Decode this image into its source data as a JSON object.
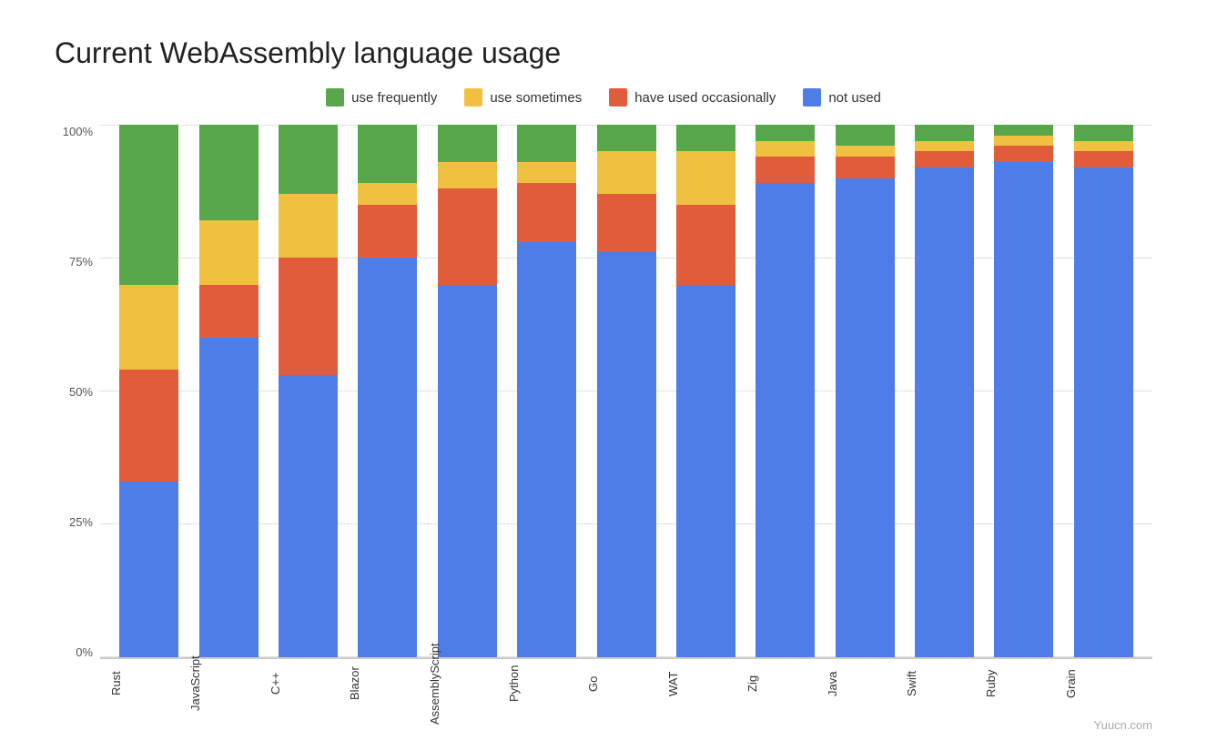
{
  "title": "Current WebAssembly language usage",
  "legend": [
    {
      "label": "use frequently",
      "color": "#57a64a"
    },
    {
      "label": "use sometimes",
      "color": "#f0c040"
    },
    {
      "label": "have used occasionally",
      "color": "#e05c3a"
    },
    {
      "label": "not used",
      "color": "#4e7de8"
    }
  ],
  "yAxis": [
    "100%",
    "75%",
    "50%",
    "25%",
    "0%"
  ],
  "colors": {
    "frequently": "#57a64a",
    "sometimes": "#f0c040",
    "occasionally": "#e05c3a",
    "notUsed": "#4e7de8"
  },
  "bars": [
    {
      "label": "Rust",
      "notUsed": 33,
      "occasionally": 21,
      "sometimes": 16,
      "frequently": 30
    },
    {
      "label": "JavaScript",
      "notUsed": 60,
      "occasionally": 10,
      "sometimes": 12,
      "frequently": 18
    },
    {
      "label": "C++",
      "notUsed": 53,
      "occasionally": 22,
      "sometimes": 12,
      "frequently": 13
    },
    {
      "label": "Blazor",
      "notUsed": 75,
      "occasionally": 10,
      "sometimes": 4,
      "frequently": 11
    },
    {
      "label": "AssemblyScript",
      "notUsed": 70,
      "occasionally": 18,
      "sometimes": 5,
      "frequently": 7
    },
    {
      "label": "Python",
      "notUsed": 78,
      "occasionally": 11,
      "sometimes": 4,
      "frequently": 7
    },
    {
      "label": "Go",
      "notUsed": 76,
      "occasionally": 11,
      "sometimes": 8,
      "frequently": 5
    },
    {
      "label": "WAT",
      "notUsed": 70,
      "occasionally": 15,
      "sometimes": 10,
      "frequently": 5
    },
    {
      "label": "Zig",
      "notUsed": 89,
      "occasionally": 5,
      "sometimes": 3,
      "frequently": 3
    },
    {
      "label": "Java",
      "notUsed": 90,
      "occasionally": 4,
      "sometimes": 2,
      "frequently": 4
    },
    {
      "label": "Swift",
      "notUsed": 92,
      "occasionally": 3,
      "sometimes": 2,
      "frequently": 3
    },
    {
      "label": "Ruby",
      "notUsed": 93,
      "occasionally": 3,
      "sometimes": 2,
      "frequently": 2
    },
    {
      "label": "Grain",
      "notUsed": 92,
      "occasionally": 3,
      "sometimes": 2,
      "frequently": 3
    }
  ],
  "watermark": "Yuucn.com"
}
